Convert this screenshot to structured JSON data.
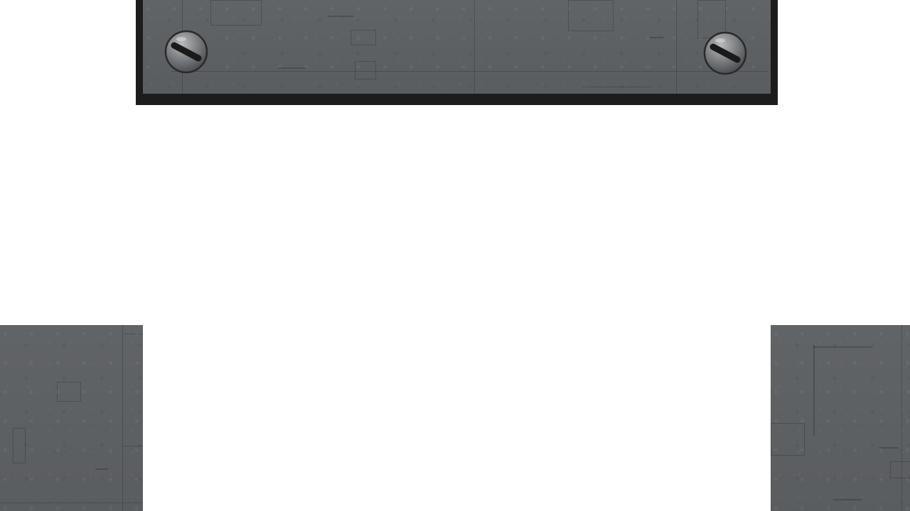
{
  "colors": {
    "panel_frame": "#1c1c1c",
    "concrete": "#5d6063",
    "background": "#ffffff"
  },
  "icons": {
    "screw_left": "screw-icon",
    "screw_right": "screw-icon"
  }
}
